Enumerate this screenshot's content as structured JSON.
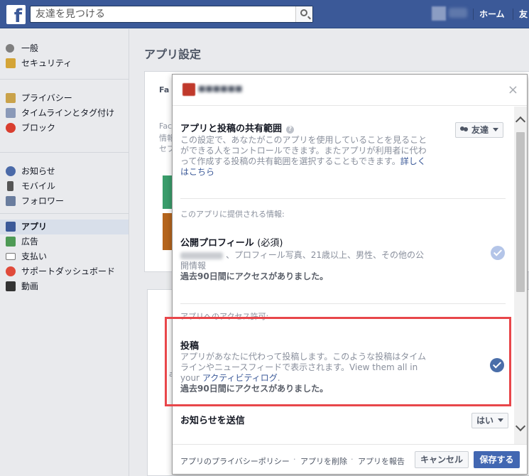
{
  "topbar": {
    "search_placeholder": "友達を見つける",
    "nav_home": "ホーム",
    "nav_friend": "友"
  },
  "sidebar": {
    "items": [
      {
        "label": "一般",
        "icon": "gears-icon"
      },
      {
        "label": "セキュリティ",
        "icon": "shield-icon"
      },
      {
        "label": "プライバシー",
        "icon": "lock-icon"
      },
      {
        "label": "タイムラインとタグ付け",
        "icon": "timeline-icon"
      },
      {
        "label": "ブロック",
        "icon": "block-icon"
      },
      {
        "label": "お知らせ",
        "icon": "globe-icon"
      },
      {
        "label": "モバイル",
        "icon": "mobile-icon"
      },
      {
        "label": "フォロワー",
        "icon": "rss-icon"
      },
      {
        "label": "アプリ",
        "icon": "apps-icon"
      },
      {
        "label": "広告",
        "icon": "ads-icon"
      },
      {
        "label": "支払い",
        "icon": "card-icon"
      },
      {
        "label": "サポートダッシュボード",
        "icon": "lifebuoy-icon"
      },
      {
        "label": "動画",
        "icon": "film-icon"
      }
    ],
    "active": "アプリ"
  },
  "main": {
    "title": "アプリ設定",
    "behind_fragments": [
      "Fa",
      "Fac",
      "情報",
      "セブ",
      "a"
    ]
  },
  "modal": {
    "close": "×",
    "audience_title": "アプリと投稿の共有範囲",
    "audience_desc": "この設定で、あなたがこのアプリを使用していることを見ることができる人をコントロールできます。またアプリが利用者に代わって作成する投稿の共有範囲を選択することもできます。",
    "audience_link": "詳しくはこちら",
    "audience_value": "友達",
    "provided_label": "このアプリに提供される情報:",
    "profile_title": "公開プロフィール",
    "profile_required": "(必須)",
    "profile_desc": "、プロフィール写真、21歳以上、男性、その他の公開情報",
    "profile_last": "過去90日間にアクセスがありました。",
    "access_label": "アプリへのアクセス許可:",
    "post_title": "投稿",
    "post_desc": "アプリがあなたに代わって投稿します。このような投稿はタイムラインやニュースフィードで表示されます。View them all in your",
    "post_link": "アクティビティログ",
    "post_period": ".",
    "post_last": "過去90日間にアクセスがありました。",
    "notify_title": "お知らせを送信",
    "notify_value": "はい"
  },
  "footer": {
    "privacy_policy": "アプリのプライバシーポリシー",
    "remove": "アプリを削除",
    "report": "アプリを報告",
    "sep": "·",
    "cancel": "キャンセル",
    "save": "保存する"
  }
}
